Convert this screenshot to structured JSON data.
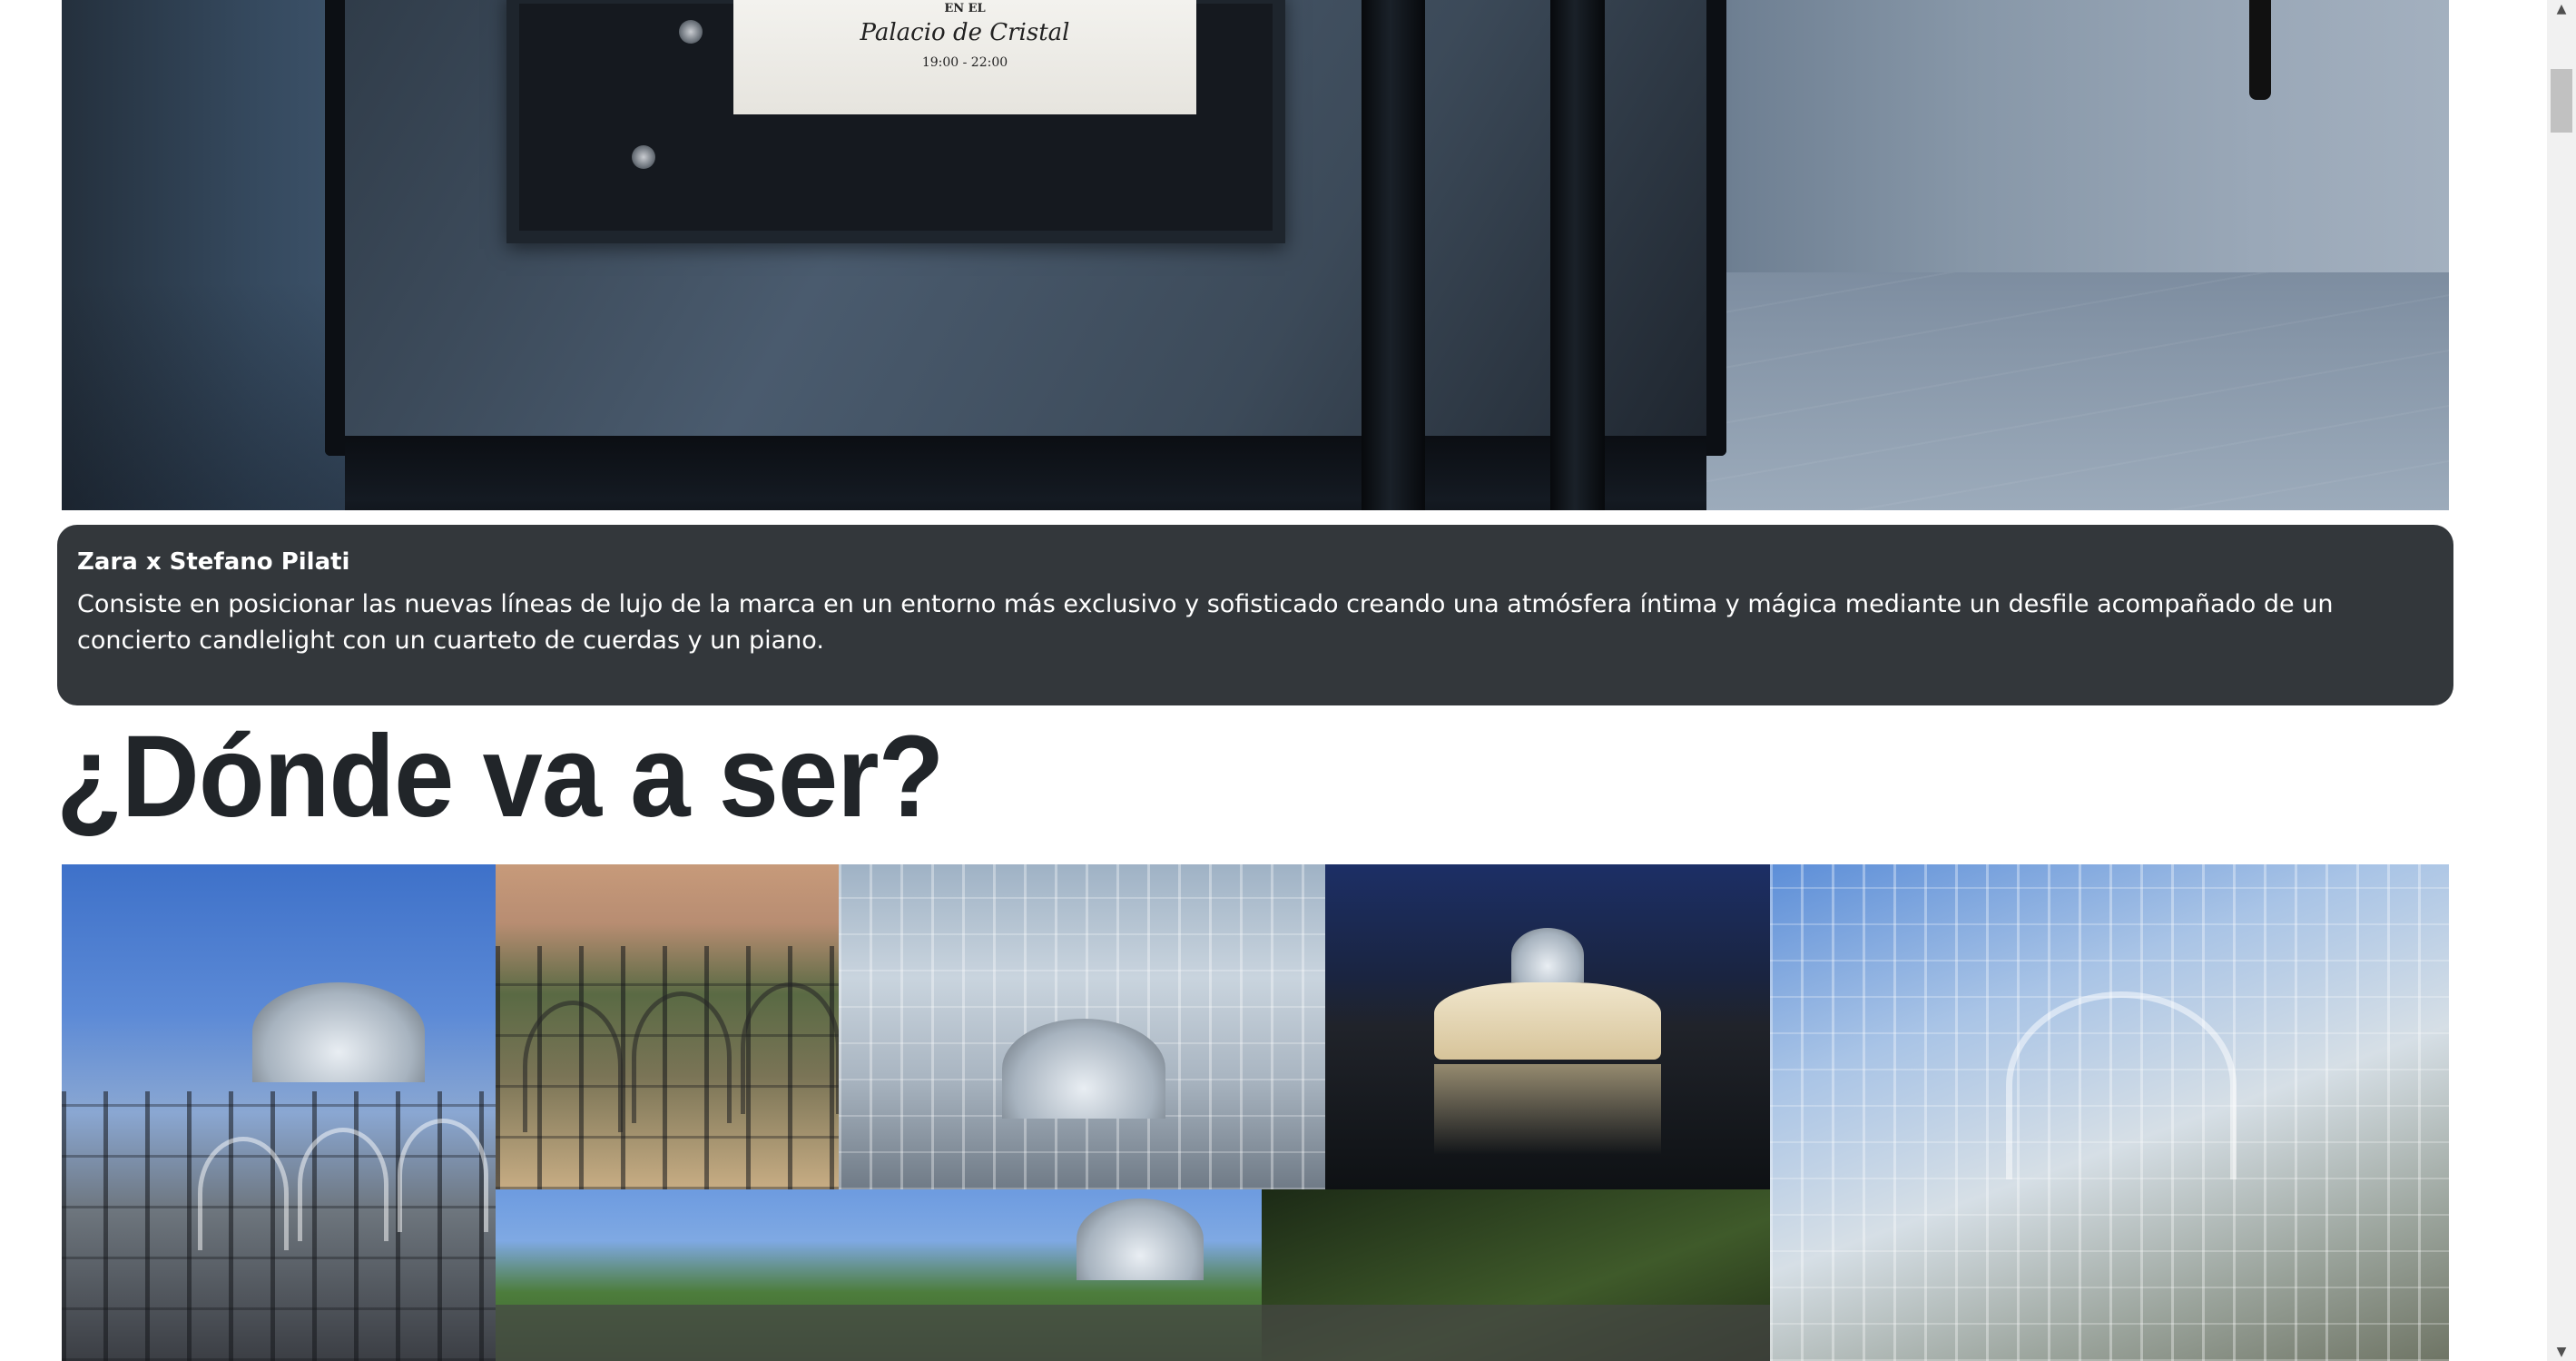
{
  "hero": {
    "poster_line_1": "EN EL",
    "poster_line_2": "Palacio de Cristal",
    "poster_time": "19:00 - 22:00"
  },
  "caption": {
    "title": "Zara x Stefano Pilati",
    "text": "Consiste en posicionar las nuevas líneas de lujo de la marca en un entorno más exclusivo y sofisticado creando una atmósfera íntima y mágica mediante un desfile acompañado de un concierto candlelight con un cuarteto de cuerdas y un piano."
  },
  "section": {
    "heading": "¿Dónde va a ser?"
  },
  "gallery": {
    "photos": [
      "crystal-palace-exterior",
      "crystal-palace-sunset",
      "crystal-palace-interior-roof",
      "crystal-palace-night",
      "crystal-palace-glass-dome",
      "crystal-palace-park-view"
    ]
  },
  "scrollbar": {
    "up_arrow": "▲",
    "down_arrow": "▼"
  },
  "colors": {
    "caption_bg": "#33373b",
    "heading_text": "#212529",
    "page_bg": "#ffffff"
  }
}
